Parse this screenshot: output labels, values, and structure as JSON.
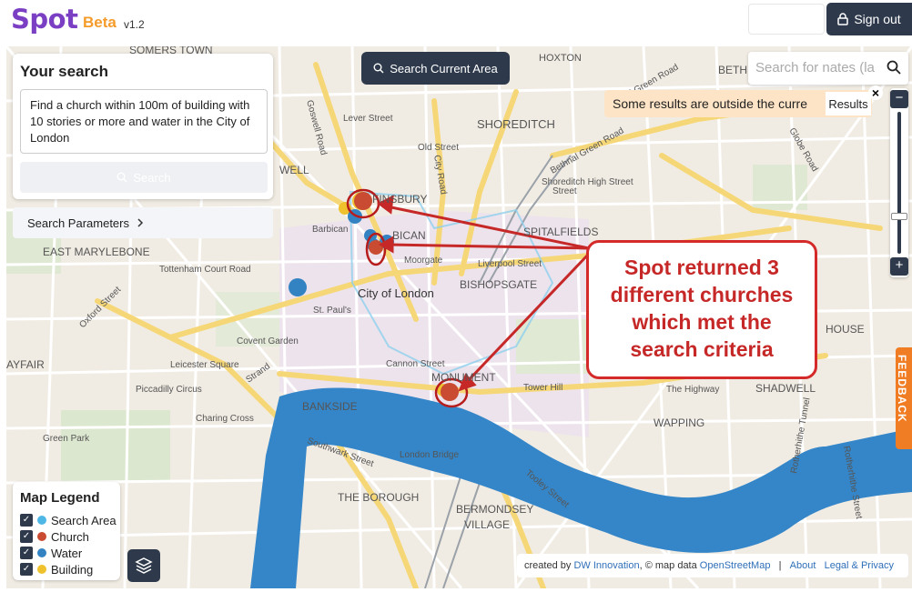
{
  "header": {
    "logo_text": "Spot",
    "beta_label": "Beta",
    "version": "v1.2",
    "sign_out_label": "Sign out"
  },
  "search_panel": {
    "title": "Your search",
    "query": "Find a church within 100m of building with 10 stories or more and water in the City of London",
    "search_button_label": "Search",
    "parameters_label": "Search Parameters"
  },
  "map_controls": {
    "search_area_button": "Search Current Area",
    "place_search_placeholder": "Search for nates (la",
    "alert_text": "Some results are outside the curre",
    "results_label": "Results",
    "close_label": "×",
    "zoom_in": "+",
    "zoom_out": "−",
    "feedback_label": "FEEDBACK"
  },
  "map_labels": [
    "SOMERS TOWN",
    "HOXTON",
    "BETHNAL G",
    "Lever Street",
    "Goswell Road",
    "SHOREDITCH",
    "Old Street",
    "City Road",
    "Bethnal Green Road",
    "Bethnal Green Road",
    "Globe Road",
    "WELL",
    "FINSBURY",
    "Shoreditch High Street",
    "SPITALFIELDS",
    "Street",
    "Barbican",
    "BICAN",
    "Moorgate",
    "Liverpool Street",
    "EAST MARYLEBONE",
    "Tottenham Court Road",
    "Oxford Street",
    "BISHOPSGATE",
    "City of London",
    "Covent Garden",
    "St. Paul's",
    "Leicester Square",
    "Piccadilly Circus",
    "Strand",
    "Cannon Street",
    "AYFAIR",
    "MONUMENT",
    "Tower Hill",
    "The Highway",
    "SHADWELL",
    "HOUSE",
    "BANKSIDE",
    "WAPPING",
    "Charing Cross",
    "Green Park",
    "Southwark Street",
    "London Bridge",
    "THE BOROUGH",
    "Tooley Street",
    "BERMONDSEY",
    "VILLAGE",
    "Rotherhithe Street",
    "Rotherhithe Tunnel"
  ],
  "annotation": {
    "lines": [
      "Spot returned 3",
      "different churches",
      "which met the",
      "search criteria"
    ]
  },
  "legend": {
    "title": "Map Legend",
    "items": [
      {
        "label": "Search Area",
        "color": "#4fb7e6"
      },
      {
        "label": "Church",
        "color": "#c94b32"
      },
      {
        "label": "Water",
        "color": "#3383c2"
      },
      {
        "label": "Building",
        "color": "#eec12d"
      }
    ]
  },
  "attribution": {
    "created_by": "created by",
    "dw": "DW Innovation",
    "map_data": ", © map data",
    "osm": "OpenStreetMap",
    "sep": "|",
    "about": "About",
    "legal": "Legal & Privacy"
  },
  "colors": {
    "accent_dark": "#2e3a4b",
    "brand_purple": "#7b3fc4",
    "brand_orange": "#f59b2a",
    "annotation_red": "#d42a2a",
    "river_blue": "#3586c8"
  }
}
